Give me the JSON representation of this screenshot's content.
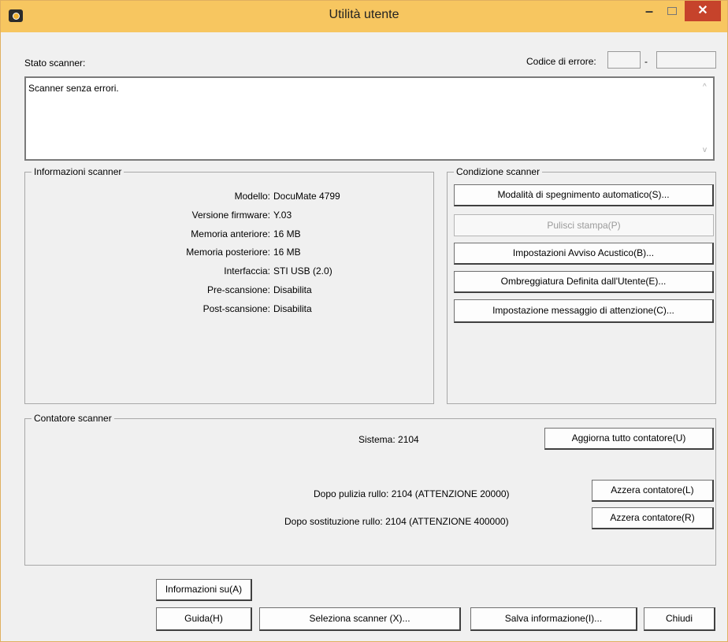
{
  "window": {
    "title": "Utilità utente"
  },
  "status": {
    "label": "Stato scanner:",
    "error_label": "Codice di errore:",
    "error_sep": "-",
    "message": "Scanner senza errori.",
    "scroll_up": "^",
    "scroll_down": "v"
  },
  "info": {
    "title": "Informazioni scanner",
    "rows": [
      {
        "key": "Modello:",
        "value": "DocuMate 4799"
      },
      {
        "key": "Versione firmware:",
        "value": "Y.03"
      },
      {
        "key": "Memoria anteriore:",
        "value": "16 MB"
      },
      {
        "key": "Memoria posteriore:",
        "value": "16 MB"
      },
      {
        "key": "Interfaccia:",
        "value": "STI USB (2.0)"
      },
      {
        "key": "Pre-scansione:",
        "value": "Disabilita"
      },
      {
        "key": "Post-scansione:",
        "value": "Disabilita"
      }
    ]
  },
  "condition": {
    "title": "Condizione scanner",
    "buttons": [
      "Modalità di spegnimento automatico(S)...",
      "Pulisci stampa(P)",
      "Impostazioni Avviso Acustico(B)...",
      "Ombreggiatura Definita dall'Utente(E)...",
      "Impostazione messaggio di attenzione(C)..."
    ]
  },
  "counter": {
    "title": "Contatore scanner",
    "system": "Sistema: 2104",
    "update_all": "Aggiorna tutto contatore(U)",
    "after_clean": "Dopo pulizia rullo: 2104 (ATTENZIONE 20000)",
    "reset_l": "Azzera contatore(L)",
    "after_replace": "Dopo sostituzione rullo: 2104 (ATTENZIONE 400000)",
    "reset_r": "Azzera contatore(R)"
  },
  "footer": {
    "about": "Informazioni su(A)",
    "help": "Guida(H)",
    "select": "Seleziona scanner (X)...",
    "save": "Salva informazione(I)...",
    "close": "Chiudi"
  }
}
